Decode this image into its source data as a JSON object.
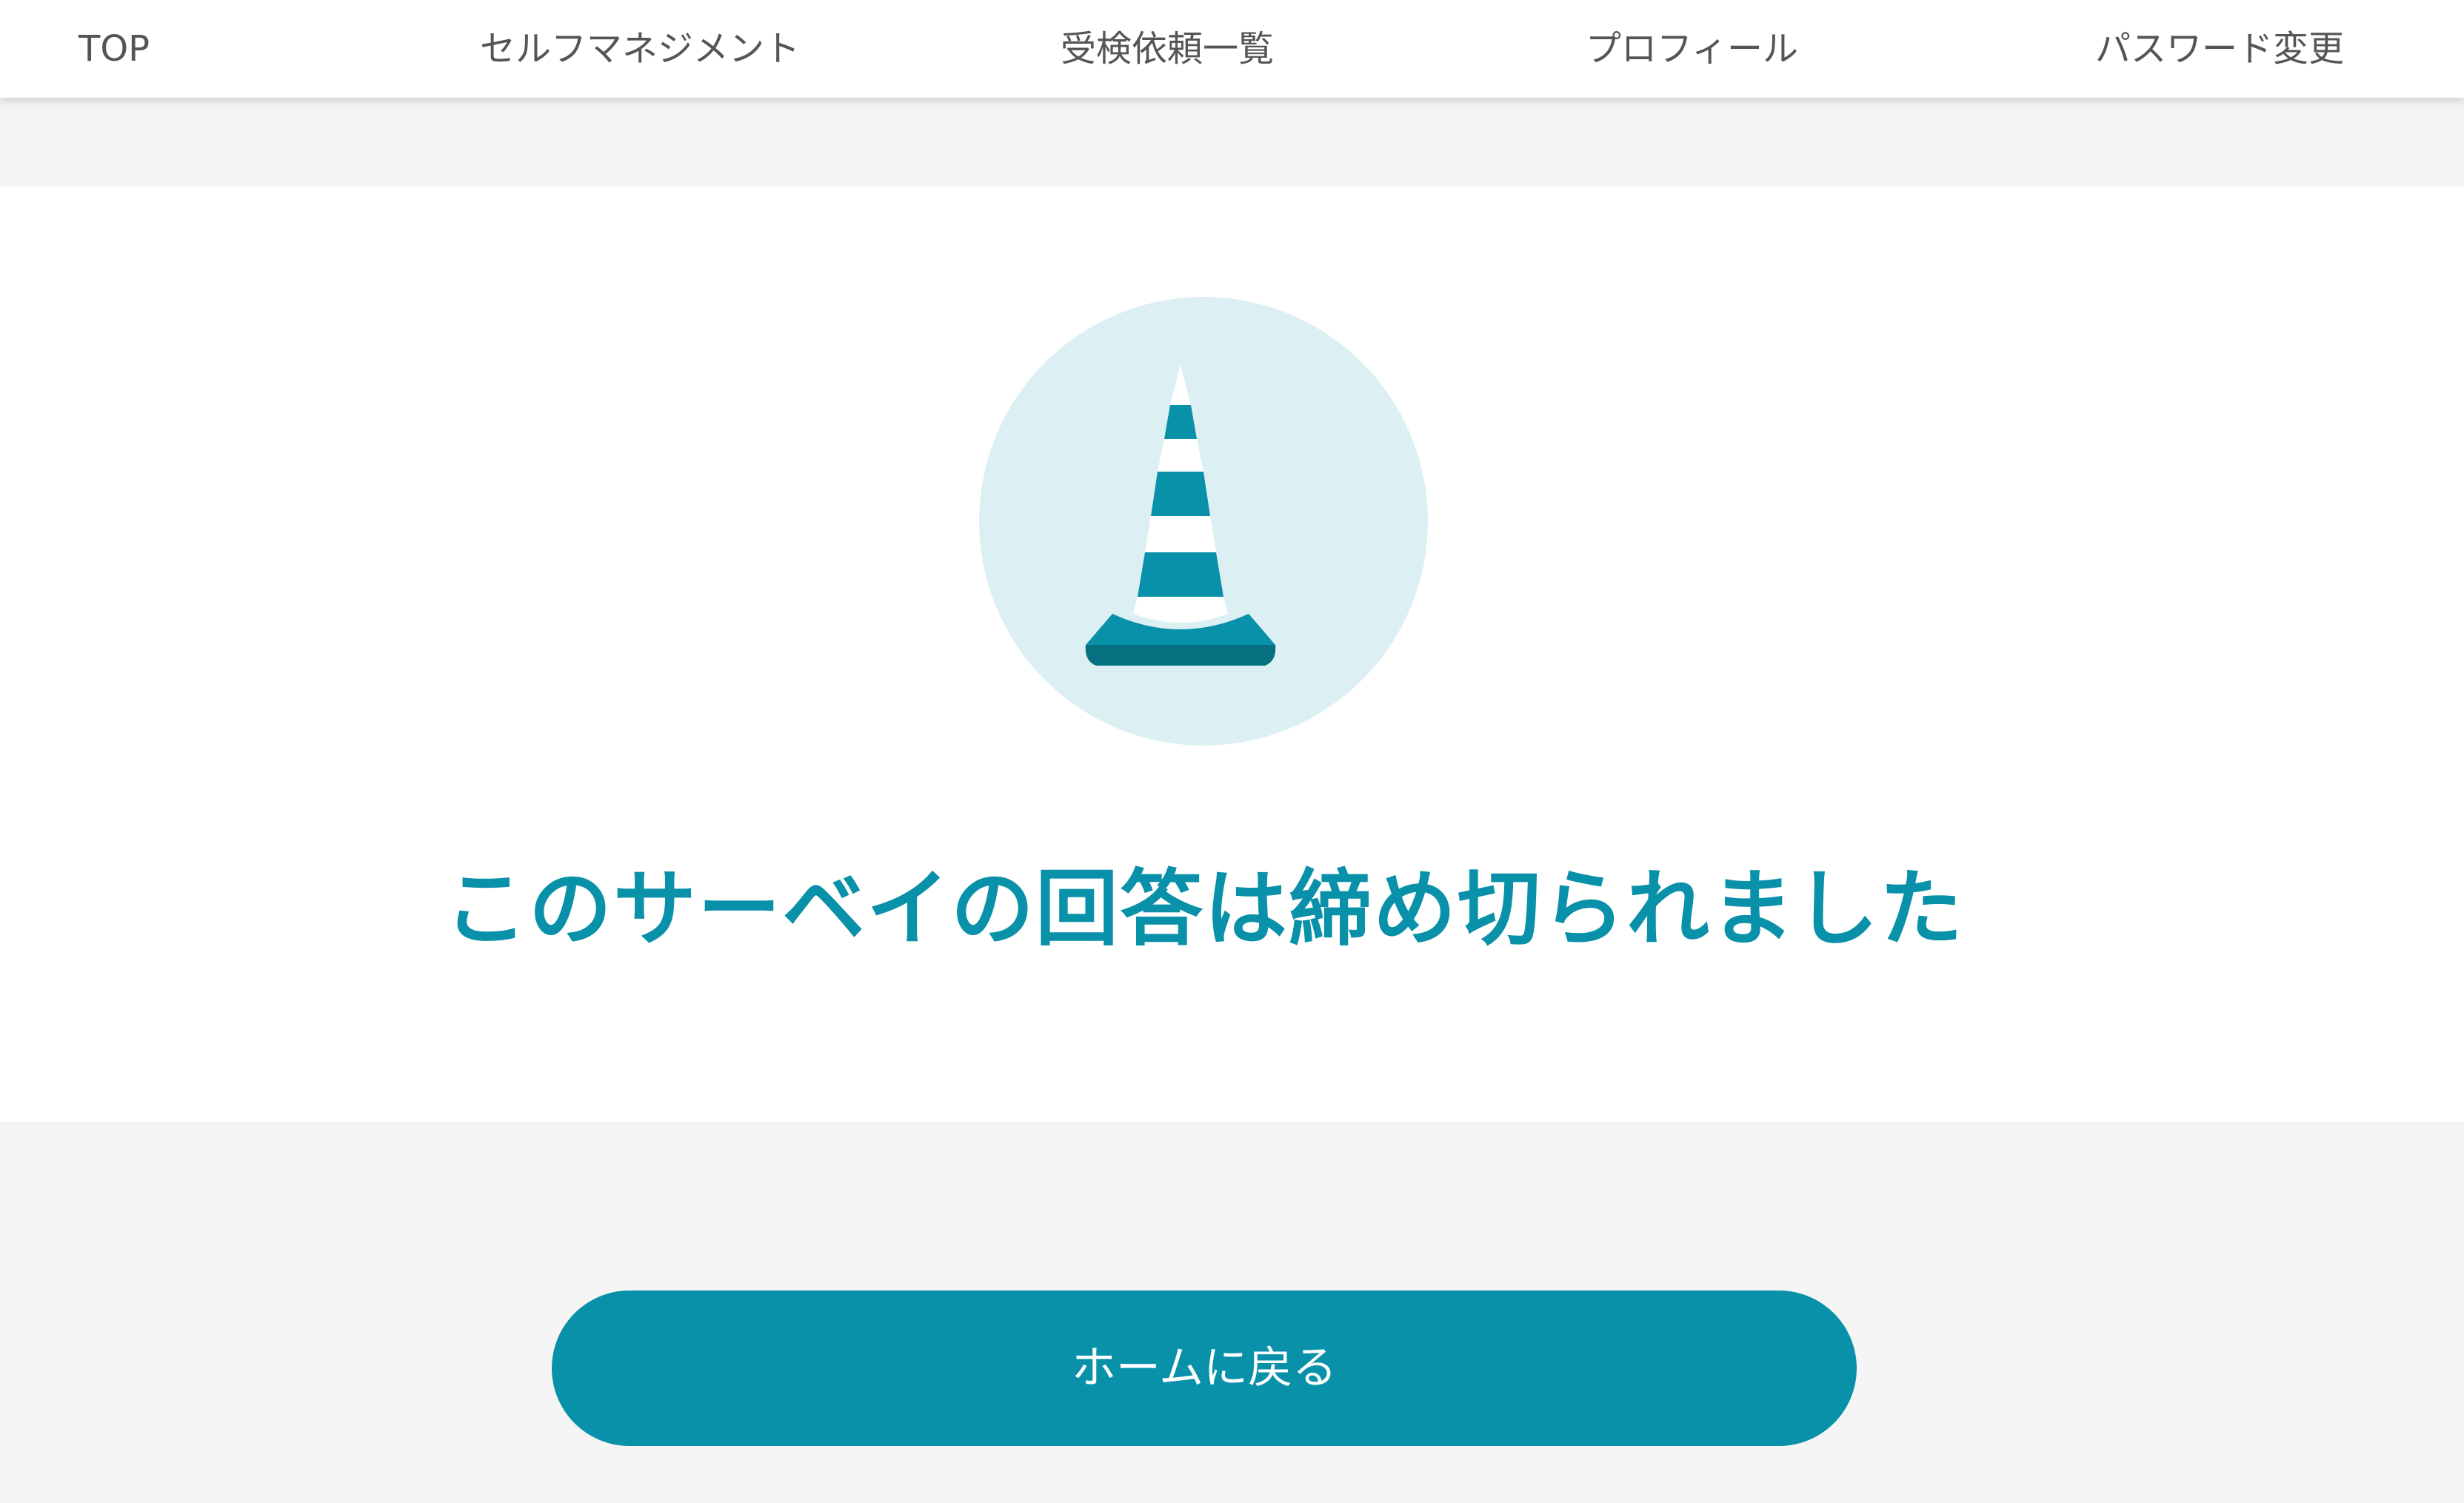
{
  "nav": {
    "items": [
      {
        "label": "TOP"
      },
      {
        "label": "セルフマネジメント"
      },
      {
        "label": "受検依頼一覧"
      },
      {
        "label": "プロフィール"
      },
      {
        "label": "パスワード変更"
      }
    ]
  },
  "status": {
    "icon": "traffic-cone-icon",
    "message": "このサーベイの回答は締め切られました"
  },
  "actions": {
    "home_label": "ホームに戻る"
  },
  "colors": {
    "accent": "#0891a8",
    "accent_dark": "#066f80",
    "icon_background": "#dcf0f3",
    "page_background": "#f5f5f5",
    "nav_text": "#555555"
  }
}
